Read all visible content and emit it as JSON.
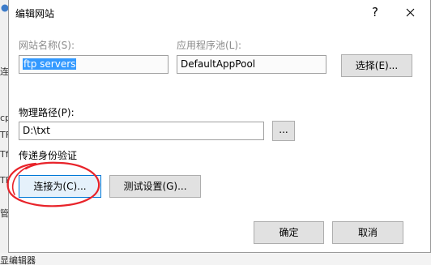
{
  "background": {
    "strip_fragments": [
      "连",
      "cp",
      "TF",
      "Tf",
      "TF",
      "管"
    ],
    "bottom_text": "显编辑器"
  },
  "dialog": {
    "title": "编辑网站",
    "help_glyph": "?",
    "close_glyph": "✕"
  },
  "site_name": {
    "label": "网站名称(S):",
    "value": "ftp servers"
  },
  "app_pool": {
    "label": "应用程序池(L):",
    "value": "DefaultAppPool",
    "select_button": "选择(E)..."
  },
  "physical_path": {
    "label": "物理路径(P):",
    "value": "D:\\txt",
    "browse_button": "..."
  },
  "pass_through": {
    "label": "传递身份验证",
    "connect_as_button": "连接为(C)...",
    "test_settings_button": "测试设置(G)..."
  },
  "footer": {
    "ok_button": "确定",
    "cancel_button": "取消"
  },
  "colors": {
    "selection": "#3399ff",
    "focus_border": "#0078d7",
    "annotation": "#e8232a"
  }
}
